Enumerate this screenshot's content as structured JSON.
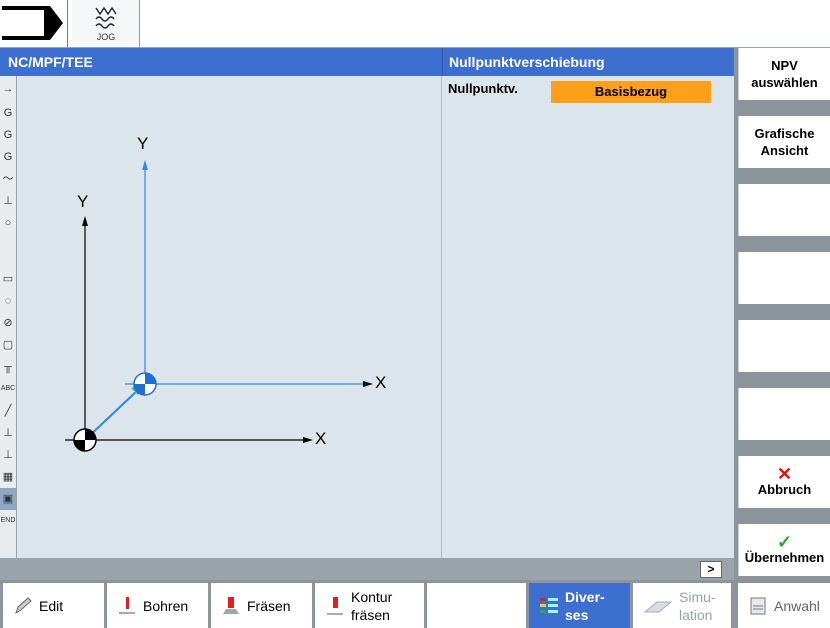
{
  "toolbar": {
    "mode_label": "JOG"
  },
  "header": {
    "program_path": "NC/MPF/TEE",
    "panel_title": "Nullpunktverschiebung"
  },
  "parameters": {
    "zero_offset_label": "Nullpunktv.",
    "zero_offset_value": "Basisbezug"
  },
  "graphic": {
    "axis_y_moved": "Y",
    "axis_x_moved": "X",
    "axis_y_origin": "Y",
    "axis_x_origin": "X"
  },
  "left_icons": [
    "arrow-icon",
    "G",
    "G",
    "G",
    "path-icon",
    "drill-icon",
    "circle-icon",
    "pocket-icon",
    "circular-pocket-icon",
    "face-icon",
    "frame-icon",
    "tool-icon",
    "ABC",
    "contour-icon",
    "drill2-icon",
    "drill3-icon",
    "pattern-icon",
    "active-icon",
    "END"
  ],
  "statusbar": {
    "more_label": ">"
  },
  "vertical_softkeys": {
    "select_zo_line1": "NPV",
    "select_zo_line2": "auswählen",
    "graphic_view_line1": "Grafische",
    "graphic_view_line2": "Ansicht",
    "cancel_label": "Abbruch",
    "accept_label": "Übernehmen"
  },
  "horizontal_softkeys": {
    "edit": "Edit",
    "drilling": "Bohren",
    "milling": "Fräsen",
    "contour_milling_line1": "Kontur",
    "contour_milling_line2": "fräsen",
    "misc_line1": "Diver-",
    "misc_line2": "ses",
    "simulation_line1": "Simu-",
    "simulation_line2": "lation",
    "select": "Anwahl"
  },
  "colors": {
    "header_blue": "#3d6fd0",
    "highlight_orange": "#ff9f1a",
    "cancel_red": "#e01010",
    "accept_green": "#22b022",
    "axis_blue": "#2e8be6"
  }
}
